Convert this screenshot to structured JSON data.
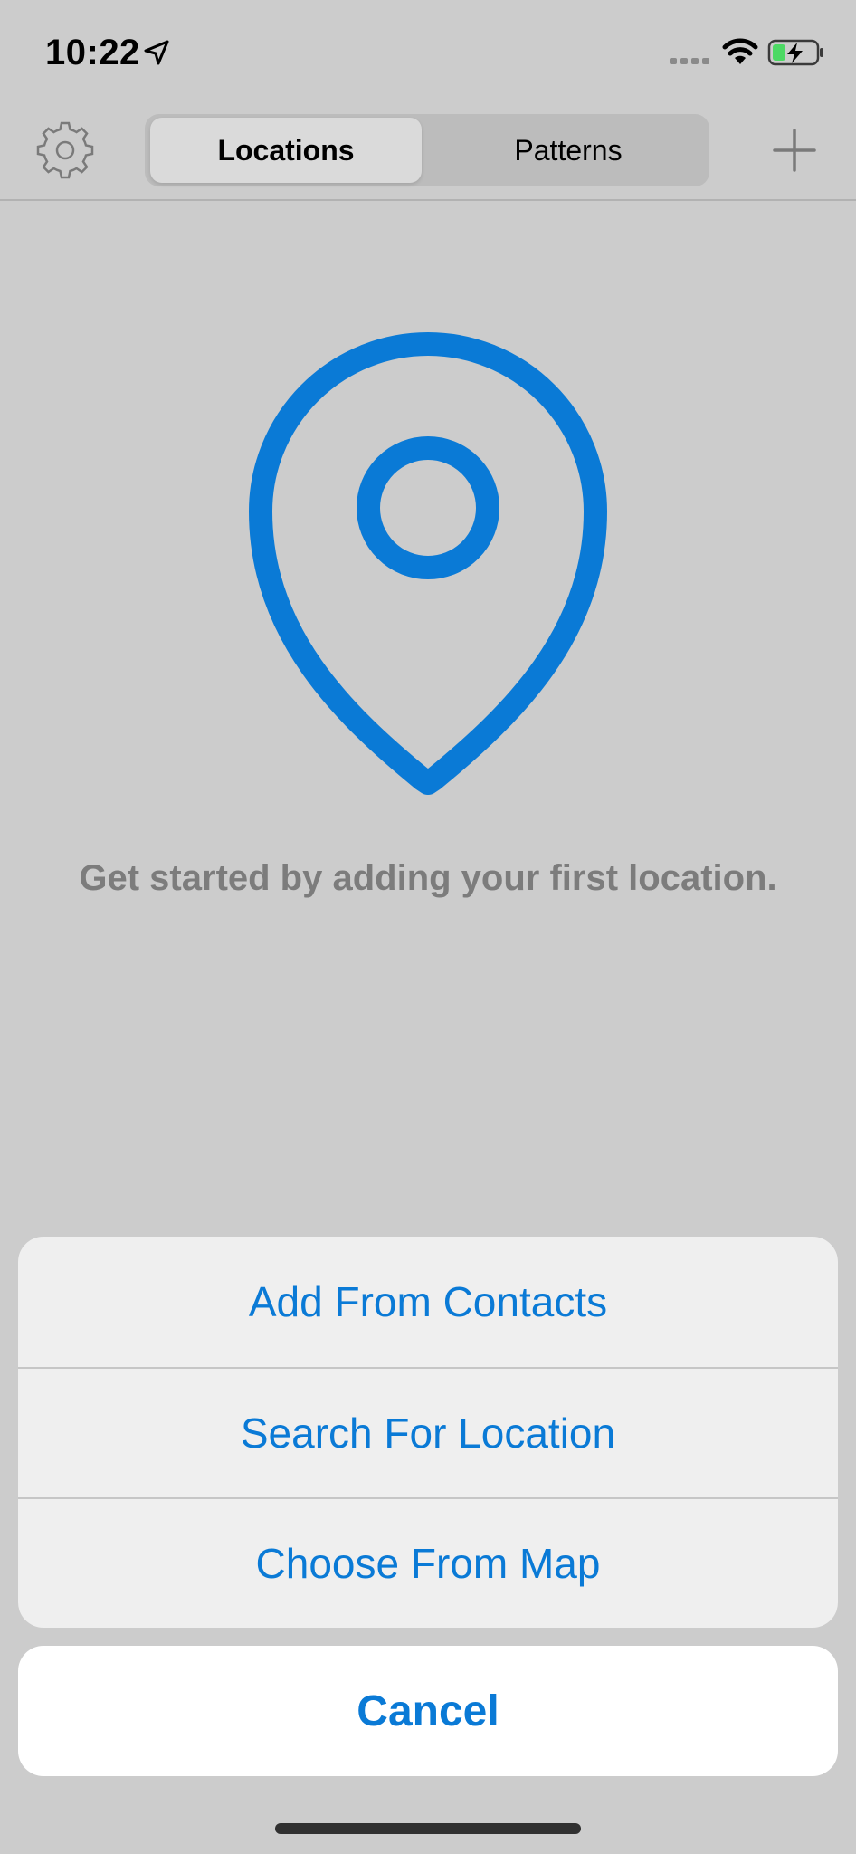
{
  "status_bar": {
    "time": "10:22",
    "icons": [
      "location-arrow-icon",
      "cellular-signal-icon",
      "wifi-icon",
      "battery-charging-icon"
    ]
  },
  "nav": {
    "settings_icon": "gear-icon",
    "segments": [
      {
        "label": "Locations",
        "selected": true
      },
      {
        "label": "Patterns",
        "selected": false
      }
    ],
    "add_icon": "plus-icon"
  },
  "empty_state": {
    "icon": "location-pin-icon",
    "message": "Get started by adding your first location."
  },
  "action_sheet": {
    "actions": [
      {
        "label": "Add From Contacts"
      },
      {
        "label": "Search For Location"
      },
      {
        "label": "Choose From Map"
      }
    ],
    "cancel_label": "Cancel"
  },
  "colors": {
    "accent": "#0a7ad6",
    "background": "#cccccc",
    "sheet_background": "#efefef",
    "battery_green": "#4cd964"
  }
}
